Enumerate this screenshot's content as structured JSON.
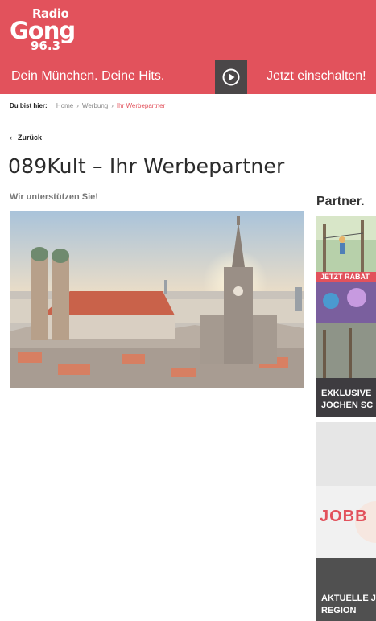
{
  "header": {
    "logo": {
      "line1": "Radio",
      "line2": "Gong",
      "line3": "96.3"
    },
    "slogan": "Dein München. Deine Hits.",
    "listen_label": "Jetzt einschalten!"
  },
  "breadcrumb": {
    "label": "Du bist hier:",
    "items": [
      "Home",
      "Werbung",
      "Ihr Werbepartner"
    ]
  },
  "back_label": "Zurück",
  "page_title": "089Kult – Ihr Werbepartner",
  "subtitle": "Wir unterstützen Sie!",
  "sidebar": {
    "heading": "Partner.",
    "card1": {
      "ribbon": "JETZT RABAT",
      "caption_line1": "EXKLUSIVE",
      "caption_line2": "JOCHEN SC"
    },
    "card2": {
      "banner": "JOBB",
      "caption_line1": "AKTUELLE J",
      "caption_line2": "REGION"
    }
  },
  "colors": {
    "brand": "#e2525c",
    "play_box": "#4a4748"
  }
}
